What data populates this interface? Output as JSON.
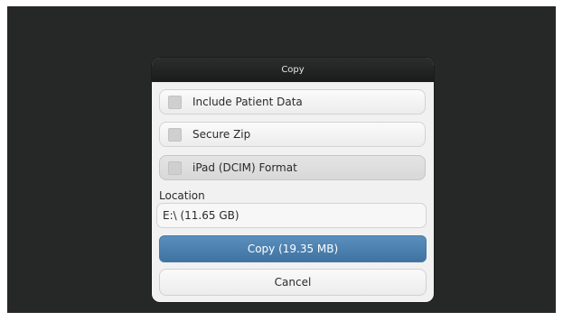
{
  "dialog": {
    "title": "Copy",
    "options": [
      {
        "label": "Include Patient Data",
        "checked": false
      },
      {
        "label": "Secure Zip",
        "checked": false
      },
      {
        "label": "iPad (DCIM) Format",
        "checked": false
      }
    ],
    "location_label": "Location",
    "location_value": "E:\\ (11.65 GB)",
    "copy_button": "Copy (19.35 MB)",
    "cancel_button": "Cancel"
  },
  "colors": {
    "background": "#262827",
    "dialog_bg": "#f1f1f1",
    "header_bg": "#1f2020",
    "primary_button": "#4c80ad"
  }
}
